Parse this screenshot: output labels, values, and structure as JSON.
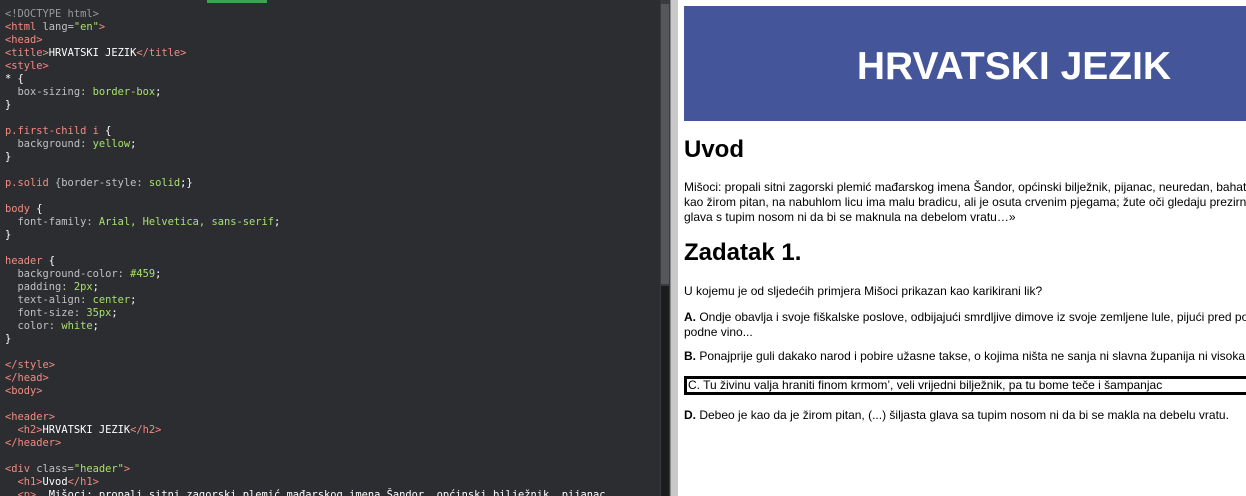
{
  "editor": {
    "code_lines": [
      [
        {
          "t": "<!DOCTYPE html>",
          "c": "cmt"
        }
      ],
      [
        {
          "t": "<html ",
          "c": "tag"
        },
        {
          "t": "lang=",
          "c": "attr"
        },
        {
          "t": "\"en\"",
          "c": "str"
        },
        {
          "t": ">",
          "c": "tag"
        }
      ],
      [
        {
          "t": "<head>",
          "c": "tag"
        }
      ],
      [
        {
          "t": "<title>",
          "c": "tag"
        },
        {
          "t": "HRVATSKI JEZIK",
          "c": "txt"
        },
        {
          "t": "</title>",
          "c": "tag"
        }
      ],
      [
        {
          "t": "<style>",
          "c": "tag"
        }
      ],
      [
        {
          "t": "* {",
          "c": "txt"
        }
      ],
      [
        {
          "t": "  box-sizing: ",
          "c": "attr"
        },
        {
          "t": "border-box",
          "c": "val"
        },
        {
          "t": ";",
          "c": "txt"
        }
      ],
      [
        {
          "t": "}",
          "c": "txt"
        }
      ],
      [],
      [
        {
          "t": "p.first-child i ",
          "c": "tag"
        },
        {
          "t": "{",
          "c": "txt"
        }
      ],
      [
        {
          "t": "  background: ",
          "c": "attr"
        },
        {
          "t": "yellow",
          "c": "val"
        },
        {
          "t": ";",
          "c": "txt"
        }
      ],
      [
        {
          "t": "}",
          "c": "txt"
        }
      ],
      [],
      [
        {
          "t": "p.solid ",
          "c": "tag"
        },
        {
          "t": "{border-style: ",
          "c": "attr"
        },
        {
          "t": "solid",
          "c": "val"
        },
        {
          "t": ";}",
          "c": "txt"
        }
      ],
      [],
      [
        {
          "t": "body ",
          "c": "tag"
        },
        {
          "t": "{",
          "c": "txt"
        }
      ],
      [
        {
          "t": "  font-family: ",
          "c": "attr"
        },
        {
          "t": "Arial, Helvetica, sans-serif",
          "c": "val"
        },
        {
          "t": ";",
          "c": "txt"
        }
      ],
      [
        {
          "t": "}",
          "c": "txt"
        }
      ],
      [],
      [
        {
          "t": "header ",
          "c": "tag"
        },
        {
          "t": "{",
          "c": "txt"
        }
      ],
      [
        {
          "t": "  background-color: ",
          "c": "attr"
        },
        {
          "t": "#459",
          "c": "val"
        },
        {
          "t": ";",
          "c": "txt"
        }
      ],
      [
        {
          "t": "  padding: ",
          "c": "attr"
        },
        {
          "t": "2px",
          "c": "val"
        },
        {
          "t": ";",
          "c": "txt"
        }
      ],
      [
        {
          "t": "  text-align: ",
          "c": "attr"
        },
        {
          "t": "center",
          "c": "val"
        },
        {
          "t": ";",
          "c": "txt"
        }
      ],
      [
        {
          "t": "  font-size: ",
          "c": "attr"
        },
        {
          "t": "35px",
          "c": "val"
        },
        {
          "t": ";",
          "c": "txt"
        }
      ],
      [
        {
          "t": "  color: ",
          "c": "attr"
        },
        {
          "t": "white",
          "c": "val"
        },
        {
          "t": ";",
          "c": "txt"
        }
      ],
      [
        {
          "t": "}",
          "c": "txt"
        }
      ],
      [],
      [
        {
          "t": "</style>",
          "c": "tag"
        }
      ],
      [
        {
          "t": "</head>",
          "c": "tag"
        }
      ],
      [
        {
          "t": "<body>",
          "c": "tag"
        }
      ],
      [],
      [
        {
          "t": "<header>",
          "c": "tag"
        }
      ],
      [
        {
          "t": "  <h2>",
          "c": "tag"
        },
        {
          "t": "HRVATSKI JEZIK",
          "c": "txt"
        },
        {
          "t": "</h2>",
          "c": "tag"
        }
      ],
      [
        {
          "t": "</header>",
          "c": "tag"
        }
      ],
      [],
      [
        {
          "t": "<div ",
          "c": "tag"
        },
        {
          "t": "class=",
          "c": "attr"
        },
        {
          "t": "\"header\"",
          "c": "str"
        },
        {
          "t": ">",
          "c": "tag"
        }
      ],
      [
        {
          "t": "  <h1>",
          "c": "tag"
        },
        {
          "t": "Uvod",
          "c": "txt"
        },
        {
          "t": "</h1>",
          "c": "tag"
        }
      ],
      [
        {
          "t": "  <p>  ",
          "c": "tag"
        },
        {
          "t": "Mišoci: propali sitni zagorski plemić mađarskog imena Šandor, općinski bilježnik, pijanac",
          "c": "txt"
        }
      ]
    ]
  },
  "preview": {
    "header_title": "HRVATSKI JEZIK",
    "h1": "Uvod",
    "intro_lines": [
      "Mišoci: propali sitni zagorski plemić mađarskog imena Šandor, općinski bilježnik, pijanac, neuredan, bahat",
      "kao žirom pitan, na nabuhlom licu ima malu bradicu, ali je osuta crvenim pjegama; žute oči gledaju prezirn",
      "glava s tupim nosom ni da bi se maknula na debelom vratu…»"
    ],
    "h2": "Zadatak 1.",
    "question": "U kojemu je od sljedećih primjera Mišoci prikazan kao karikirani lik?",
    "options": {
      "a": {
        "letter": "A.",
        "line1": " Ondje obavlja i svoje fiškalske poslove, odbijajući smrdljive dimove iz svoje zemljene lule, pijući pred po",
        "line2": "podne vino..."
      },
      "b": {
        "letter": "B.",
        "line1": " Ponajprije guli dakako narod i pobire užasne takse, o kojima ništa ne sanja ni slavna županija ni visoka"
      },
      "c": {
        "letter": "C.",
        "line1": " Tu živinu valja hraniti finom krmom’, veli vrijedni bilježnik, pa tu bome teče i šampanjac"
      },
      "d": {
        "letter": "D.",
        "line1": " Debeo je kao da je žirom pitan, (...) šiljasta glava sa tupim nosom ni da bi se makla na debelu vratu."
      }
    }
  }
}
